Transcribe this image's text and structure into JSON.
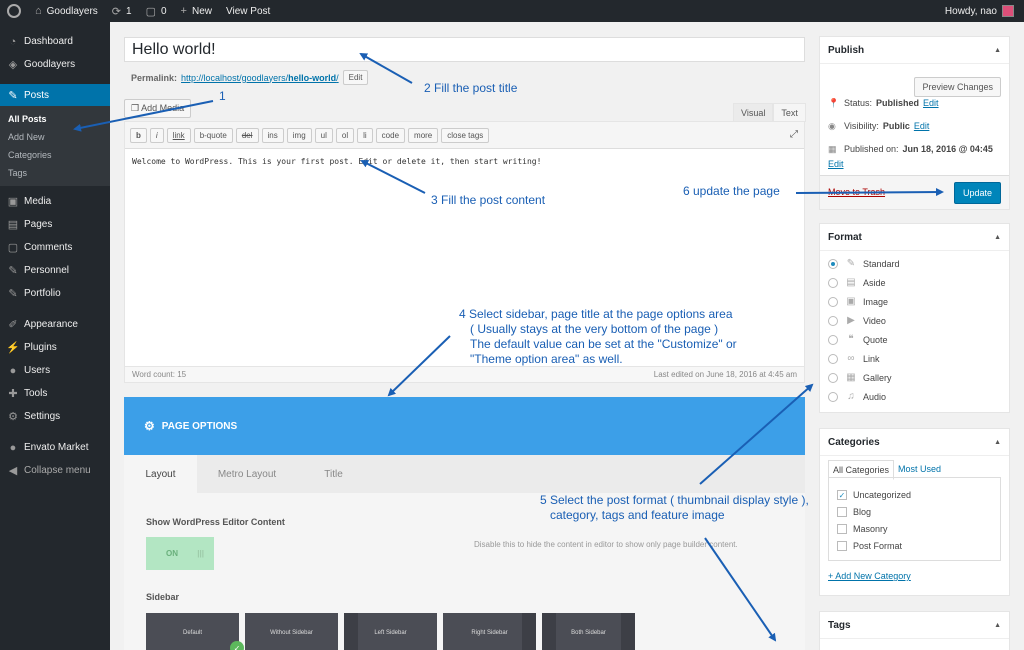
{
  "adminbar": {
    "site_name": "Goodlayers",
    "updates_count": "1",
    "comments_count": "0",
    "new_label": "New",
    "view_post": "View Post",
    "howdy": "Howdy, nao"
  },
  "sidebar": {
    "dashboard": "Dashboard",
    "goodlayers": "Goodlayers",
    "posts": "Posts",
    "sub": [
      "All Posts",
      "Add New",
      "Categories",
      "Tags"
    ],
    "media": "Media",
    "pages": "Pages",
    "comments": "Comments",
    "personnel": "Personnel",
    "portfolio": "Portfolio",
    "appearance": "Appearance",
    "plugins": "Plugins",
    "users": "Users",
    "tools": "Tools",
    "settings": "Settings",
    "envato": "Envato Market",
    "collapse": "Collapse menu"
  },
  "editor": {
    "title": "Hello world!",
    "permalink_label": "Permalink:",
    "permalink_url_base": "http://localhost/goodlayers/",
    "permalink_slug": "hello-world",
    "permalink_end": "/",
    "edit_btn": "Edit",
    "add_media": "Add Media",
    "tab_visual": "Visual",
    "tab_text": "Text",
    "qt_buttons": [
      "b",
      "i",
      "link",
      "b-quote",
      "del",
      "ins",
      "img",
      "ul",
      "ol",
      "li",
      "code",
      "more",
      "close tags"
    ],
    "content": "Welcome to WordPress. This is your first post. Edit or delete it, then start writing!",
    "word_count": "Word count: 15",
    "last_edited": "Last edited on June 18, 2016 at 4:45 am"
  },
  "page_options": {
    "header": "PAGE OPTIONS",
    "tabs": [
      "Layout",
      "Metro Layout",
      "Title"
    ],
    "show_editor_label": "Show WordPress Editor Content",
    "toggle_on": "ON",
    "toggle_desc": "Disable this to hide the content in editor to show only page builder content.",
    "sidebar_label": "Sidebar",
    "sidebars": [
      "Default",
      "Without Sidebar",
      "Left Sidebar",
      "Right Sidebar",
      "Both Sidebar"
    ]
  },
  "publish": {
    "title": "Publish",
    "preview": "Preview Changes",
    "status_label": "Status:",
    "status_value": "Published",
    "visibility_label": "Visibility:",
    "visibility_value": "Public",
    "published_label": "Published on:",
    "published_value": "Jun 18, 2016 @ 04:45",
    "edit": "Edit",
    "trash": "Move to Trash",
    "update": "Update"
  },
  "format": {
    "title": "Format",
    "options": [
      "Standard",
      "Aside",
      "Image",
      "Video",
      "Quote",
      "Link",
      "Gallery",
      "Audio"
    ]
  },
  "categories": {
    "title": "Categories",
    "tab_all": "All Categories",
    "tab_used": "Most Used",
    "items": [
      "Uncategorized",
      "Blog",
      "Masonry",
      "Post Format"
    ],
    "add_new": "+ Add New Category"
  },
  "tags": {
    "title": "Tags"
  },
  "annotations": {
    "a1": "1",
    "a2": "2 Fill the post title",
    "a3": "3 Fill the post content",
    "a4_l1": "4 Select sidebar, page title at the page options area",
    "a4_l2": "( Usually stays at the very bottom of the page )",
    "a4_l3": "The default value can be set at the \"Customize\" or",
    "a4_l4": "\"Theme option area\" as well.",
    "a5_l1": "5 Select the post format ( thumbnail display style ),",
    "a5_l2": "category, tags and feature image",
    "a6": "6 update the page"
  }
}
